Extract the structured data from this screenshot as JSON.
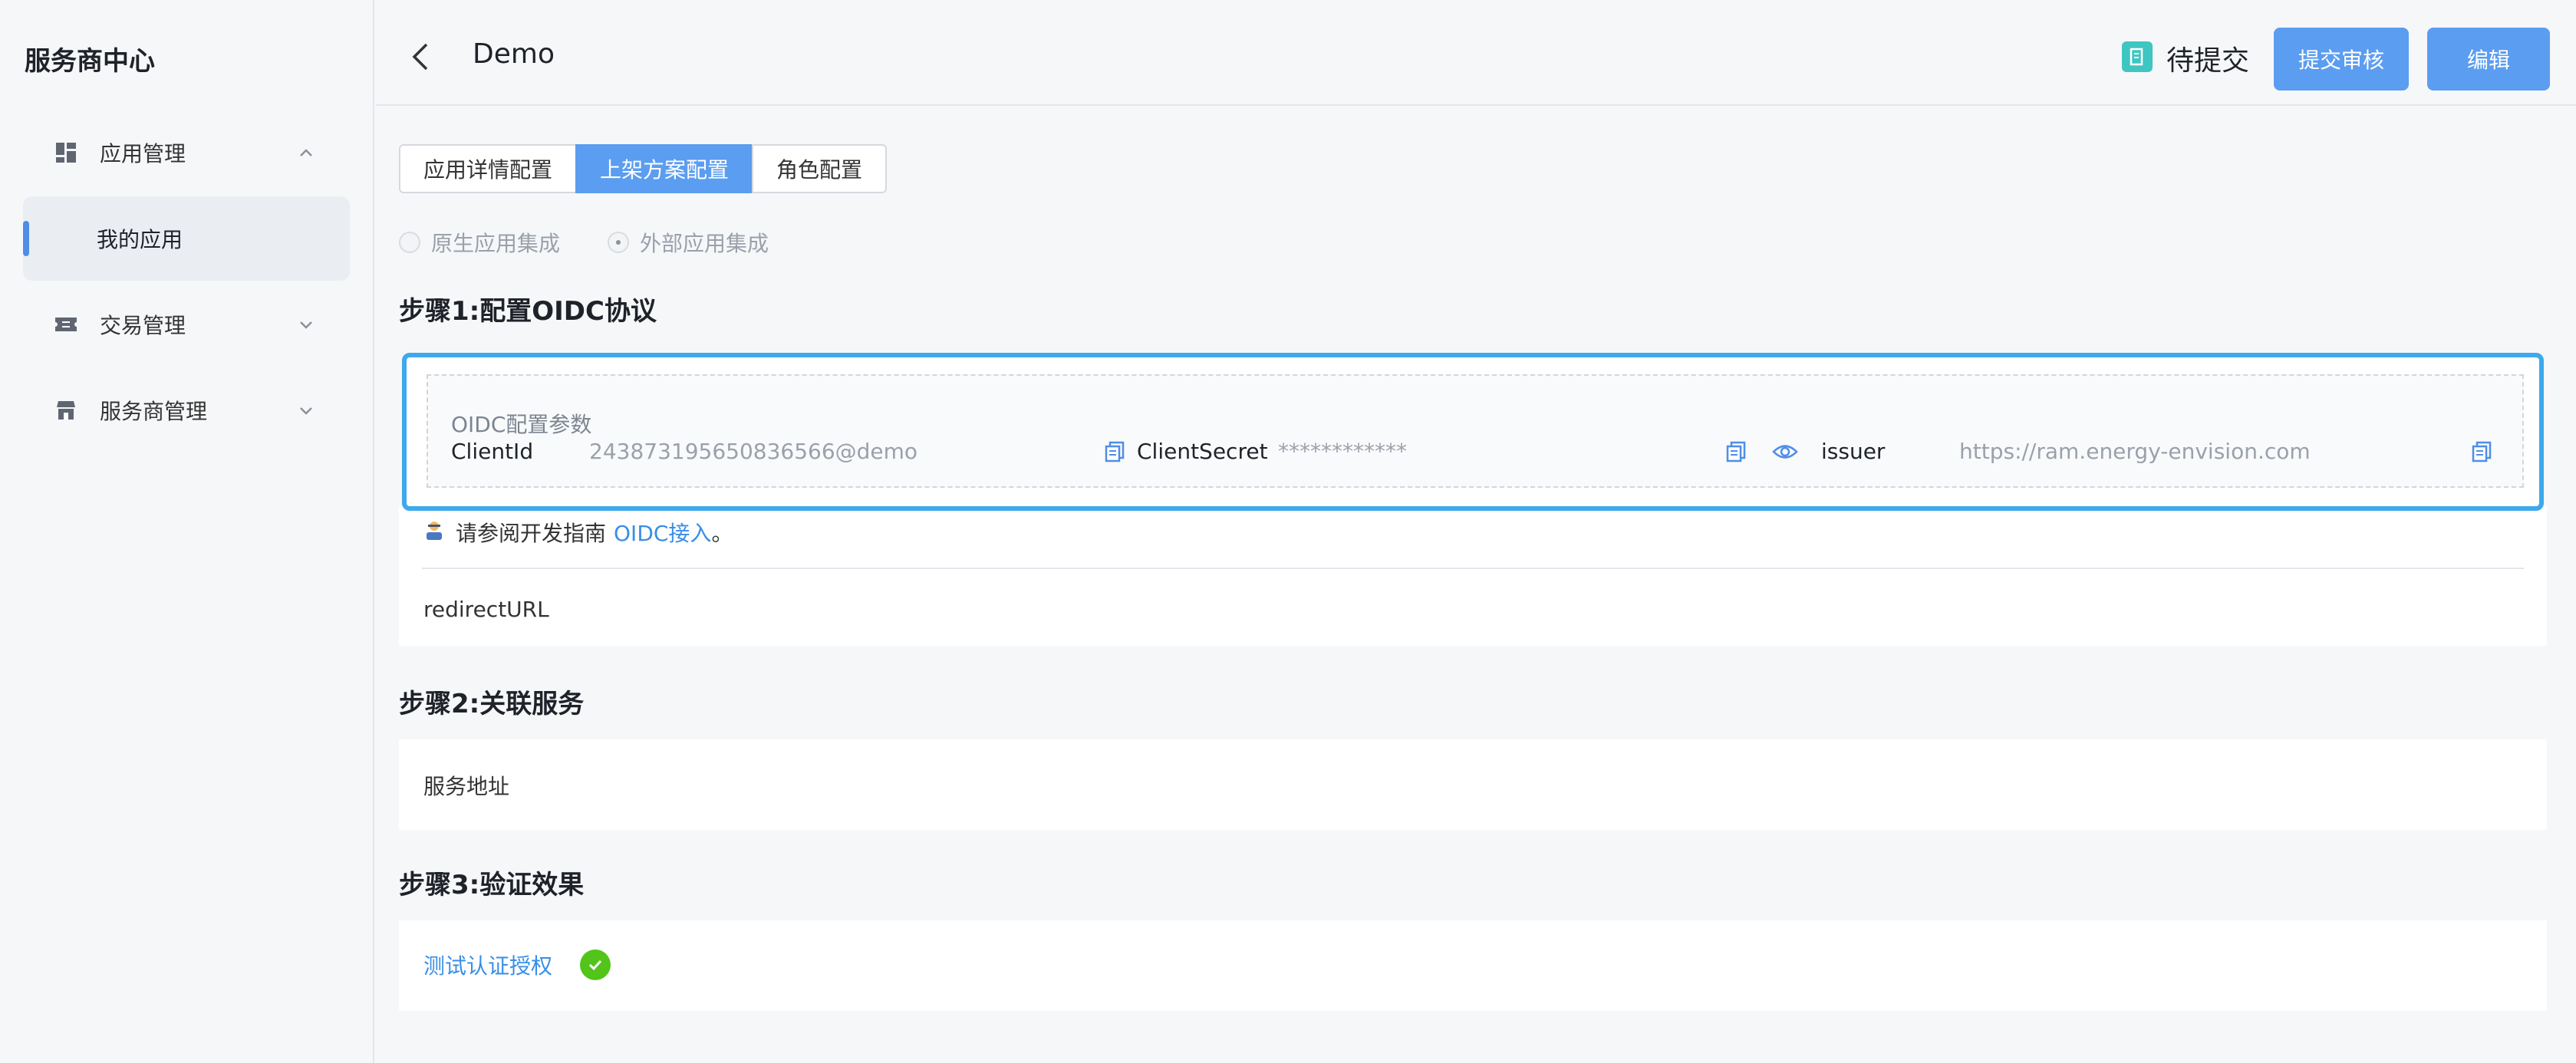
{
  "sidebar": {
    "title": "服务商中心",
    "items": [
      {
        "label": "应用管理",
        "icon": "dashboard-icon"
      },
      {
        "label": "我的应用"
      },
      {
        "label": "交易管理",
        "icon": "ticket-icon"
      },
      {
        "label": "服务商管理",
        "icon": "shop-icon"
      }
    ]
  },
  "header": {
    "title": "Demo",
    "status": "待提交",
    "status_color": "#3fc6c2",
    "submit_label": "提交审核",
    "edit_label": "编辑"
  },
  "tabs": [
    {
      "label": "应用详情配置",
      "active": false
    },
    {
      "label": "上架方案配置",
      "active": true
    },
    {
      "label": "角色配置",
      "active": false
    }
  ],
  "integration": {
    "native_label": "原生应用集成",
    "external_label": "外部应用集成",
    "selected": "外部应用集成"
  },
  "step1": {
    "title": "步骤1:配置OIDC协议",
    "oidc_caption": "OIDC配置参数",
    "client_id_key": "ClientId",
    "client_id_value": "243873195650836566@demo",
    "client_secret_key": "ClientSecret",
    "client_secret_value": "************",
    "issuer_key": "issuer",
    "issuer_value": "https://ram.energy-envision.com",
    "hint_prefix": "请参阅开发指南",
    "hint_link": "OIDC接入",
    "hint_suffix": "。",
    "redirect_label": "redirectURL"
  },
  "step2": {
    "title": "步骤2:关联服务",
    "service_label": "服务地址"
  },
  "step3": {
    "title": "步骤3:验证效果",
    "test_link": "测试认证授权"
  },
  "colors": {
    "primary": "#5b9df0",
    "highlight_border": "#3ea9ec",
    "success": "#52c41a",
    "link": "#3a8ee6"
  }
}
